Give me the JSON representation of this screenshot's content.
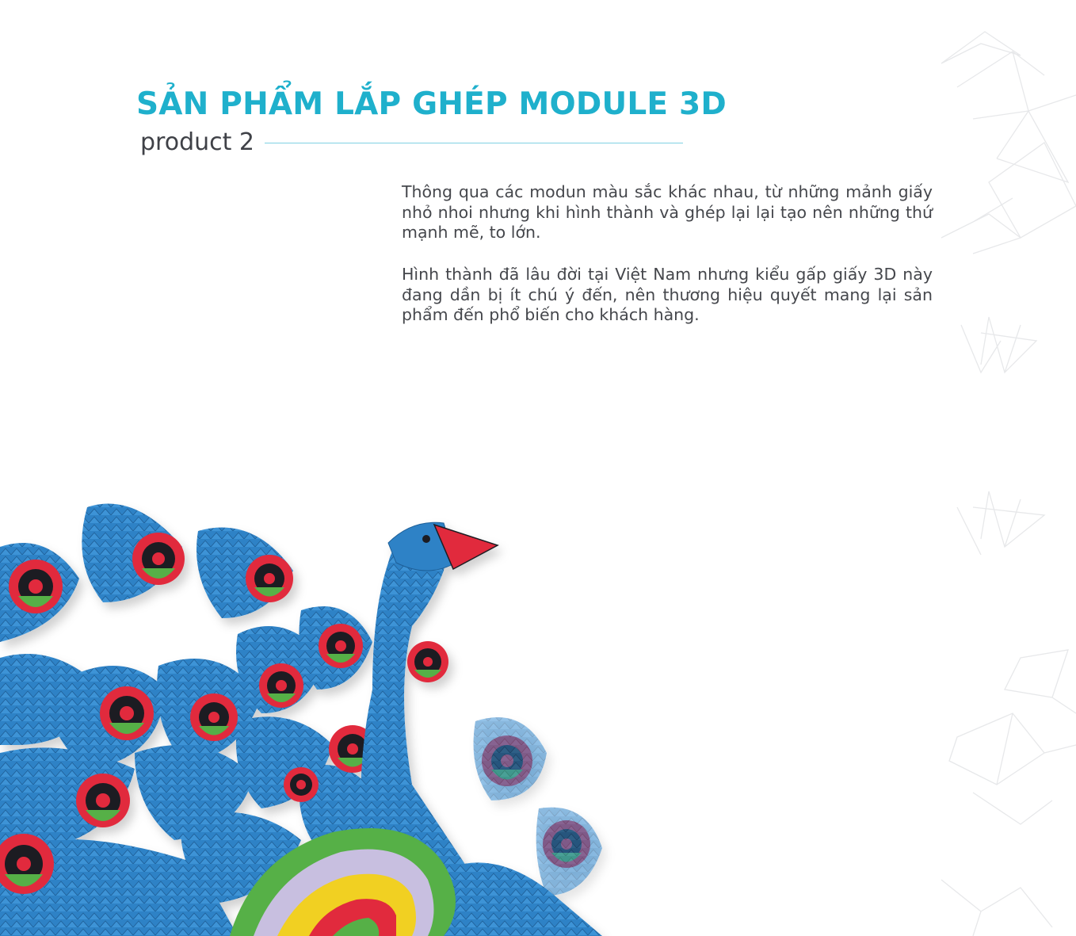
{
  "header": {
    "title": "SẢN PHẨM LẮP GHÉP MODULE 3D",
    "subtitle": "product 2"
  },
  "description": {
    "paragraph_1": "Thông qua các modun màu sắc khác nhau, từ những mảnh giấy nhỏ nhoi nhưng khi hình thành và ghép lại lại tạo nên những thứ mạnh mẽ, to lớn.",
    "paragraph_2": "Hình thành đã lâu đời tại Việt Nam nhưng kiểu gấp giấy 3D này đang dần bị ít chú ý đến, nên thương hiệu quyết mang lại sản phẩm đến phổ biến cho khách hàng."
  },
  "colors": {
    "accent": "#1fb0cc",
    "rule": "#7fd0e2",
    "text": "#45474c",
    "paper_blue": "#2f82c6",
    "paper_red": "#e12a3c",
    "paper_green": "#56b047",
    "paper_black": "#1d1d24",
    "paper_yellow": "#f1d022",
    "paper_lavender": "#c8bfe0"
  },
  "icons": {
    "background_decoration": "geometric-line-art-icon",
    "product_image": "origami-peacock-icon"
  }
}
